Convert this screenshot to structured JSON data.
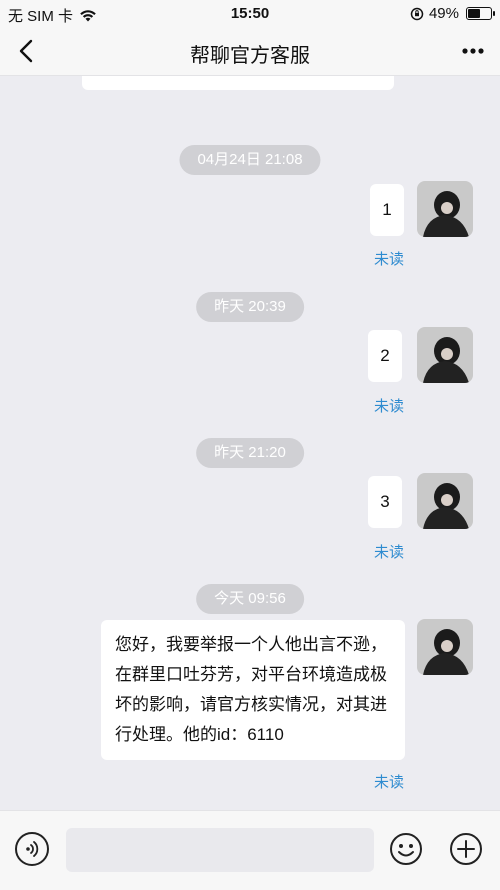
{
  "status_bar": {
    "carrier": "无 SIM 卡",
    "time": "15:50",
    "battery_percent": "49%",
    "battery_level": 0.49
  },
  "header": {
    "title": "帮聊官方客服",
    "back_icon": "chevron-left-icon",
    "more_icon": "more-dots-icon"
  },
  "messages": [
    {
      "timestamp": "04月24日 21:08",
      "text": "1",
      "status": "未读"
    },
    {
      "timestamp": "昨天 20:39",
      "text": "2",
      "status": "未读"
    },
    {
      "timestamp": "昨天 21:20",
      "text": "3",
      "status": "未读"
    },
    {
      "timestamp": "今天 09:56",
      "lines": [
        "您好，我要举报一个人他出言不逊，",
        "在群里口吐芬芳，对平台环境造成极",
        "坏的影响，请官方核实情况，对其进",
        "行处理。他的id：6110"
      ],
      "status": "未读"
    }
  ],
  "input_bar": {
    "voice_icon": "voice-icon",
    "emoji_icon": "emoji-icon",
    "plus_icon": "plus-icon",
    "text_value": ""
  }
}
